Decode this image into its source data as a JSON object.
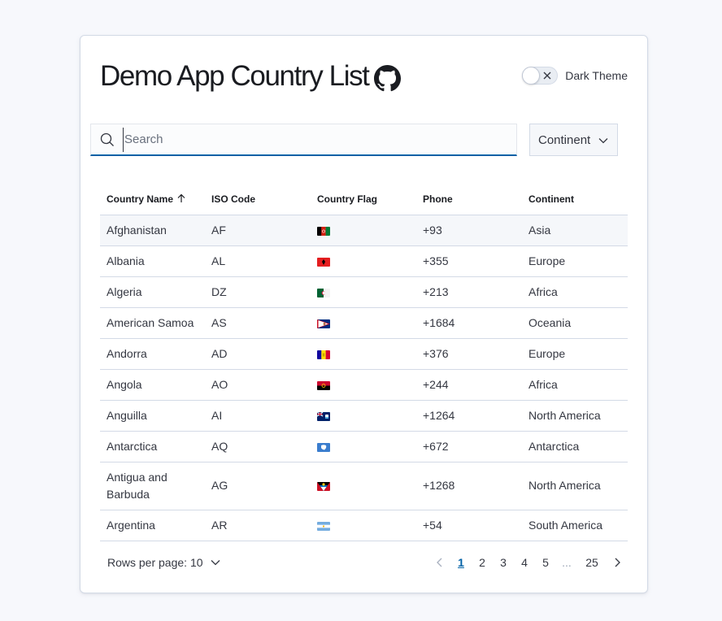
{
  "header": {
    "title": "Demo App Country List",
    "github_icon": "github-icon",
    "theme_toggle_label": "Dark Theme",
    "theme_toggle_on": false
  },
  "search": {
    "placeholder": "Search",
    "value": ""
  },
  "filter": {
    "continent_label": "Continent"
  },
  "table": {
    "columns": [
      "Country Name",
      "ISO Code",
      "Country Flag",
      "Phone",
      "Continent"
    ],
    "sort_column": "Country Name",
    "sort_direction": "ascending",
    "rows": [
      {
        "name": "Afghanistan",
        "iso": "AF",
        "flag": "flag-af",
        "phone": "+93",
        "continent": "Asia"
      },
      {
        "name": "Albania",
        "iso": "AL",
        "flag": "flag-al",
        "phone": "+355",
        "continent": "Europe"
      },
      {
        "name": "Algeria",
        "iso": "DZ",
        "flag": "flag-dz",
        "phone": "+213",
        "continent": "Africa"
      },
      {
        "name": "American Samoa",
        "iso": "AS",
        "flag": "flag-as",
        "phone": "+1684",
        "continent": "Oceania"
      },
      {
        "name": "Andorra",
        "iso": "AD",
        "flag": "flag-ad",
        "phone": "+376",
        "continent": "Europe"
      },
      {
        "name": "Angola",
        "iso": "AO",
        "flag": "flag-ao",
        "phone": "+244",
        "continent": "Africa"
      },
      {
        "name": "Anguilla",
        "iso": "AI",
        "flag": "flag-ai",
        "phone": "+1264",
        "continent": "North America"
      },
      {
        "name": "Antarctica",
        "iso": "AQ",
        "flag": "flag-aq",
        "phone": "+672",
        "continent": "Antarctica"
      },
      {
        "name": "Antigua and Barbuda",
        "iso": "AG",
        "flag": "flag-ag",
        "phone": "+1268",
        "continent": "North America"
      },
      {
        "name": "Argentina",
        "iso": "AR",
        "flag": "flag-ar",
        "phone": "+54",
        "continent": "South America"
      }
    ]
  },
  "pagination": {
    "rows_per_page_label": "Rows per page: 10",
    "pages": [
      "1",
      "2",
      "3",
      "4",
      "5"
    ],
    "ellipsis": "...",
    "last_page": "25",
    "current_page": "1"
  },
  "colors": {
    "accent": "#0061a6",
    "border": "#d3dae6",
    "background": "#f7f8fc"
  }
}
